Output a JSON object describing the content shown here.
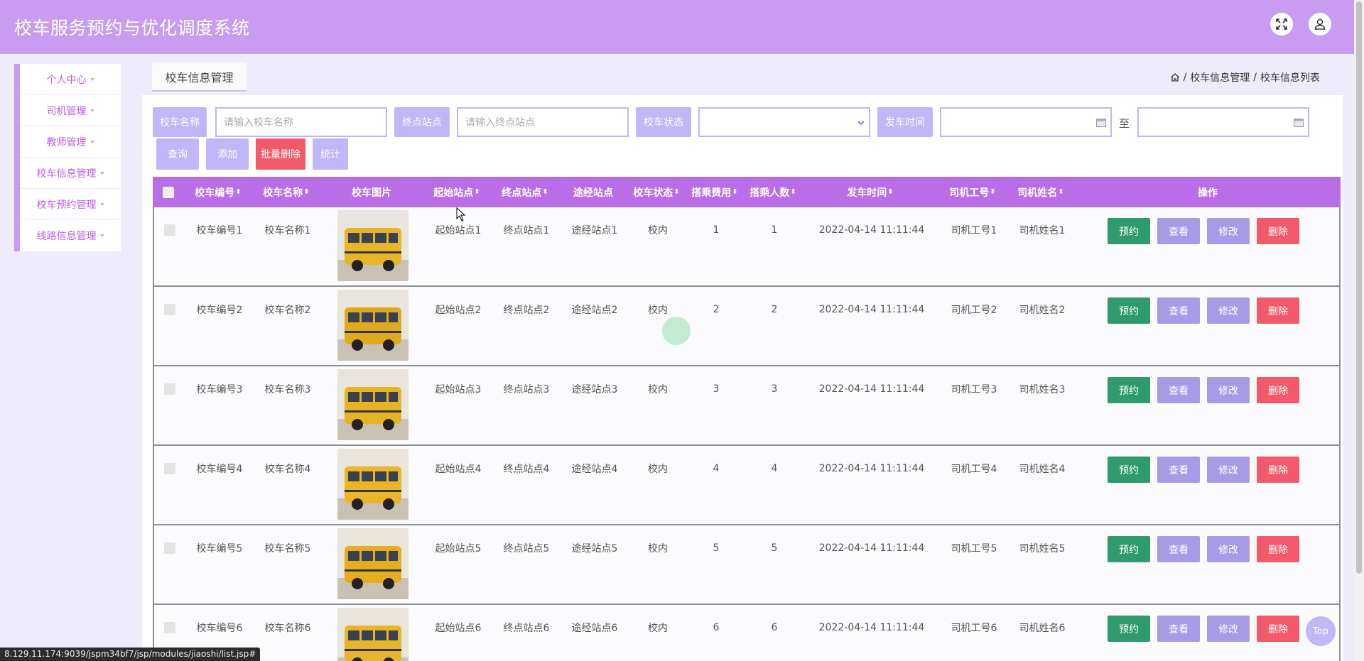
{
  "header": {
    "title": "校车服务预约与优化调度系统",
    "fullscreen_icon": "expand-icon",
    "user_icon": "user-icon"
  },
  "sidebar": {
    "items": [
      {
        "label": "个人中心"
      },
      {
        "label": "司机管理"
      },
      {
        "label": "教师管理"
      },
      {
        "label": "校车信息管理"
      },
      {
        "label": "校车预约管理"
      },
      {
        "label": "线路信息管理"
      }
    ]
  },
  "tab": {
    "label": "校车信息管理"
  },
  "breadcrumb": {
    "home_icon": "home-icon",
    "sep": "/",
    "level1": "校车信息管理",
    "level2": "校车信息列表"
  },
  "filters": {
    "name_label": "校车名称",
    "name_placeholder": "请输入校车名称",
    "end_label": "终点站点",
    "end_placeholder": "请输入终点站点",
    "status_label": "校车状态",
    "status_value": "",
    "time_label": "发车时间",
    "time_from": "",
    "to_label": "至",
    "time_to": ""
  },
  "buttons": {
    "query": "查询",
    "add": "添加",
    "batch_delete": "批量删除",
    "stats": "统计"
  },
  "table": {
    "columns": [
      "校车编号",
      "校车名称",
      "校车图片",
      "起始站点",
      "终点站点",
      "途经站点",
      "校车状态",
      "搭乘费用",
      "搭乘人数",
      "发车时间",
      "司机工号",
      "司机姓名",
      "操作"
    ],
    "sortable": [
      true,
      true,
      false,
      true,
      true,
      false,
      true,
      true,
      true,
      true,
      true,
      true,
      false
    ],
    "actions": [
      "预约",
      "查看",
      "修改",
      "删除"
    ],
    "rows": [
      {
        "id": "校车编号1",
        "name": "校车名称1",
        "start": "起始站点1",
        "end": "终点站点1",
        "via": "途经站点1",
        "status": "校内",
        "fee": "1",
        "count": "1",
        "time": "2022-04-14 11:11:44",
        "driver_no": "司机工号1",
        "driver_name": "司机姓名1"
      },
      {
        "id": "校车编号2",
        "name": "校车名称2",
        "start": "起始站点2",
        "end": "终点站点2",
        "via": "途经站点2",
        "status": "校内",
        "fee": "2",
        "count": "2",
        "time": "2022-04-14 11:11:44",
        "driver_no": "司机工号2",
        "driver_name": "司机姓名2"
      },
      {
        "id": "校车编号3",
        "name": "校车名称3",
        "start": "起始站点3",
        "end": "终点站点3",
        "via": "途经站点3",
        "status": "校内",
        "fee": "3",
        "count": "3",
        "time": "2022-04-14 11:11:44",
        "driver_no": "司机工号3",
        "driver_name": "司机姓名3"
      },
      {
        "id": "校车编号4",
        "name": "校车名称4",
        "start": "起始站点4",
        "end": "终点站点4",
        "via": "途经站点4",
        "status": "校内",
        "fee": "4",
        "count": "4",
        "time": "2022-04-14 11:11:44",
        "driver_no": "司机工号4",
        "driver_name": "司机姓名4"
      },
      {
        "id": "校车编号5",
        "name": "校车名称5",
        "start": "起始站点5",
        "end": "终点站点5",
        "via": "途经站点5",
        "status": "校内",
        "fee": "5",
        "count": "5",
        "time": "2022-04-14 11:11:44",
        "driver_no": "司机工号5",
        "driver_name": "司机姓名5"
      },
      {
        "id": "校车编号6",
        "name": "校车名称6",
        "start": "起始站点6",
        "end": "终点站点6",
        "via": "途经站点6",
        "status": "校内",
        "fee": "6",
        "count": "6",
        "time": "2022-04-14 11:11:44",
        "driver_no": "司机工号6",
        "driver_name": "司机姓名6"
      }
    ]
  },
  "status_url": "8.129.11.174:9039/jspm34bf7/jsp/modules/jiaoshi/list.jsp#",
  "top_button": "Top",
  "colors": {
    "header": "#c99cf1",
    "accent": "#c1b6f7",
    "table_head": "#b96ee7",
    "reserve": "#2e9a6e",
    "view": "#a79be6",
    "delete": "#f25a6b"
  }
}
